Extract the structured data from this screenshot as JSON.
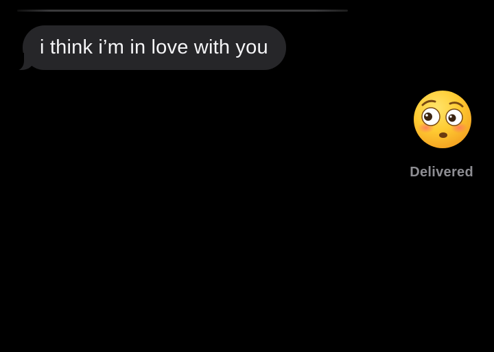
{
  "conversation": {
    "messages": [
      {
        "direction": "received",
        "type": "text",
        "text": "i think i’m in love with you",
        "bubble_color": "#262629",
        "text_color": "#f5f5f7"
      },
      {
        "direction": "sent",
        "type": "emoji",
        "emoji": "flushed-face",
        "status": "Delivered"
      }
    ]
  },
  "colors": {
    "background": "#000000",
    "status_text": "#8e8e93",
    "emoji_face": "#ffcc33"
  }
}
